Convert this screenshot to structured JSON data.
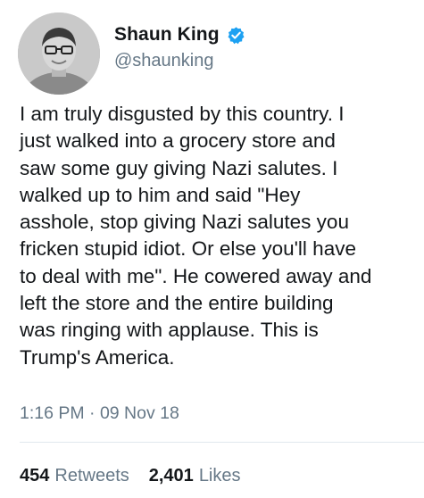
{
  "user": {
    "display_name": "Shaun King",
    "handle": "@shaunking",
    "verified": true,
    "avatar_icon": "profile-photo"
  },
  "tweet": {
    "text": "I am truly disgusted by this country. I\njust walked into a grocery store and\nsaw some guy giving Nazi salutes. I\nwalked up to him and said \"Hey\nasshole, stop giving Nazi salutes you\nfricken stupid idiot. Or else you'll have\nto deal with me\". He cowered away and\nleft the store and the entire building\nwas ringing with applause. This is\nTrump's America.",
    "timestamp": "1:16 PM · 09 Nov 18"
  },
  "stats": {
    "retweets_count": "454",
    "retweets_label": "Retweets",
    "likes_count": "2,401",
    "likes_label": "Likes"
  },
  "colors": {
    "verified_blue": "#1da1f2",
    "secondary_text": "#657786",
    "primary_text": "#14171a"
  }
}
